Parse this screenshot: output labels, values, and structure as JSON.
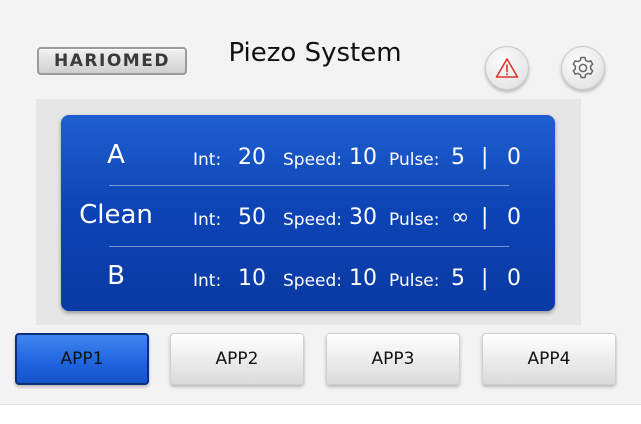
{
  "header": {
    "logo_text": "HARIOMED",
    "title": "Piezo System",
    "alarm_icon": "warning-triangle-icon",
    "settings_icon": "gear-icon"
  },
  "programs": [
    {
      "name": "A",
      "int_label": "Int:",
      "int": "20",
      "speed_label": "Speed:",
      "speed": "10",
      "pulse_label": "Pulse:",
      "pulse": "5",
      "sep": "|",
      "extra": "0"
    },
    {
      "name": "Clean",
      "int_label": "Int:",
      "int": "50",
      "speed_label": "Speed:",
      "speed": "30",
      "pulse_label": "Pulse:",
      "pulse": "∞",
      "sep": "|",
      "extra": "0"
    },
    {
      "name": "B",
      "int_label": "Int:",
      "int": "10",
      "speed_label": "Speed:",
      "speed": "10",
      "pulse_label": "Pulse:",
      "pulse": "5",
      "sep": "|",
      "extra": "0"
    }
  ],
  "apps": [
    {
      "label": "APP1",
      "active": true
    },
    {
      "label": "APP2",
      "active": false
    },
    {
      "label": "APP3",
      "active": false
    },
    {
      "label": "APP4",
      "active": false
    }
  ],
  "colors": {
    "panel_blue": "#0c43b4",
    "active_button": "#1e63de",
    "alarm_red": "#d9342b"
  }
}
